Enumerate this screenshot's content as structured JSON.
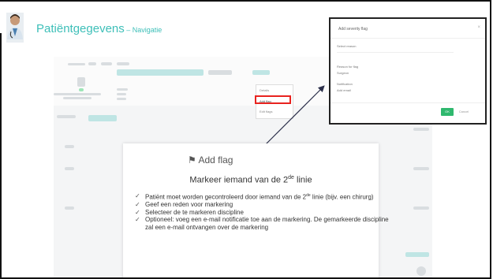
{
  "header": {
    "title": "Patiëntgegevens",
    "separator": " – ",
    "subtitle": "Navigatie"
  },
  "context_menu": {
    "items": [
      "Details",
      "Add flag",
      "Edit flags"
    ]
  },
  "modal": {
    "title": "Add severity flag",
    "field1": "Select reason",
    "label2": "Reason for flag",
    "value2": "Surgeon",
    "label3": "Notification",
    "value3": "Add email",
    "ok_label": "OK",
    "cancel_label": "Cancel",
    "close_glyph": "×"
  },
  "card": {
    "flag_glyph": "⚑",
    "flag_label": "Add flag",
    "heading_pre": "Markeer iemand van de 2",
    "heading_sup": "de",
    "heading_post": " linie",
    "bullets": {
      "b1_pre": "Patiënt moet worden gecontroleerd door iemand van de 2",
      "b1_sup": "de",
      "b1_post": " linie (bijv. een chirurg)",
      "b2": "Geef een reden voor markering",
      "b3": "Selecteer de te markeren discipline",
      "b4": "Optioneel: voeg een e-mail notificatie toe aan de markering. De gemarkeerde discipline zal een e-mail ontvangen over de markering"
    },
    "tick_glyph": "✓"
  },
  "colors": {
    "title_teal": "#3dbfb8",
    "highlight_red": "#e8231f",
    "ok_green": "#2fb86e"
  }
}
